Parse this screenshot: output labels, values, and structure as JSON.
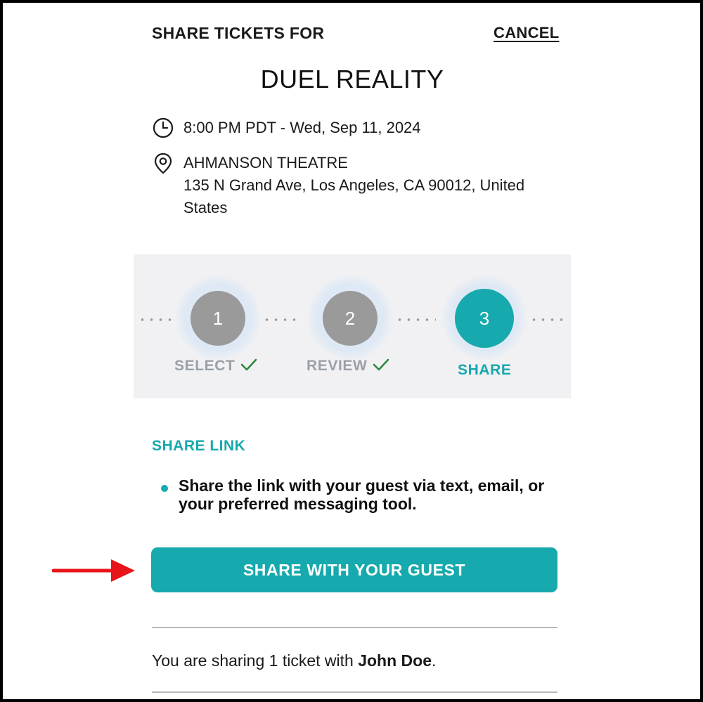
{
  "header": {
    "title": "SHARE TICKETS FOR",
    "cancel_label": "CANCEL"
  },
  "event": {
    "name": "DUEL REALITY",
    "datetime": "8:00 PM PDT - Wed, Sep 11, 2024",
    "venue": "AHMANSON THEATRE",
    "address": "135 N Grand Ave, Los Angeles, CA 90012, United States",
    "time_icon": "clock-icon",
    "venue_icon": "map-pin-icon"
  },
  "stepper": {
    "steps": [
      {
        "number": "1",
        "label": "SELECT",
        "state": "completed"
      },
      {
        "number": "2",
        "label": "REVIEW",
        "state": "completed"
      },
      {
        "number": "3",
        "label": "SHARE",
        "state": "active"
      }
    ],
    "check_icon": "checkmark-icon"
  },
  "share_link": {
    "title": "SHARE LINK",
    "instruction": "Share the link with your guest via text, email, or your preferred messaging tool.",
    "button_label": "SHARE WITH YOUR GUEST"
  },
  "summary": {
    "prefix": "You are sharing 1 ticket with ",
    "guest_name": "John Doe",
    "suffix": "."
  },
  "annotation": {
    "arrow_icon": "red-arrow-icon"
  },
  "colors": {
    "accent": "#16a9ad",
    "completed_step": "#9a9a9a",
    "check_green": "#2e8b3a",
    "annotation_red": "#e8141b",
    "stepper_background": "#f1f1f3"
  }
}
